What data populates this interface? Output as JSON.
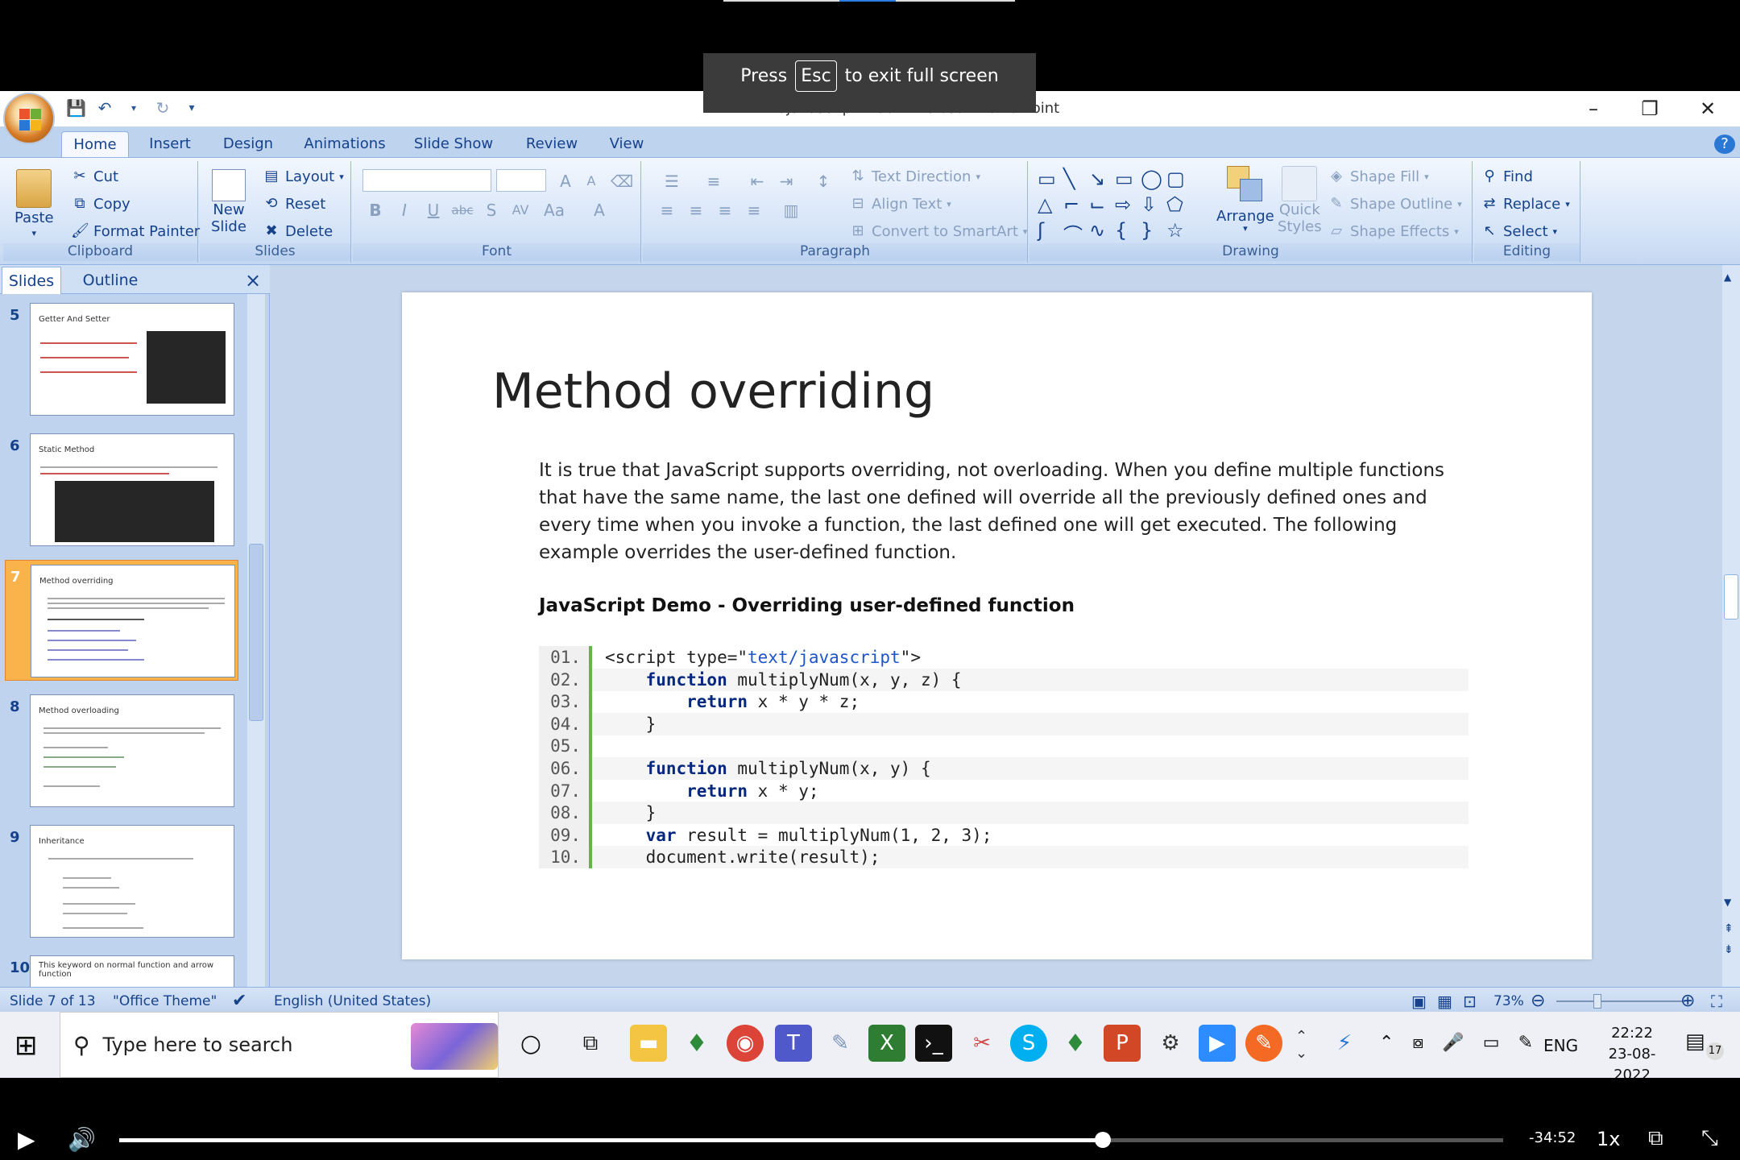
{
  "fullscreen_notice": {
    "press": "Press",
    "key": "Esc",
    "rest": "to exit full screen"
  },
  "window": {
    "title": "8javascript -ES6 - Microsoft PowerPoint",
    "minimize": "–",
    "restore": "❐",
    "close": "✕"
  },
  "ribbon_tabs": [
    "Home",
    "Insert",
    "Design",
    "Animations",
    "Slide Show",
    "Review",
    "View"
  ],
  "clipboard": {
    "paste": "Paste",
    "cut": "Cut",
    "copy": "Copy",
    "format_painter": "Format Painter",
    "label": "Clipboard"
  },
  "slides_group": {
    "new_slide": "New",
    "new_slide2": "Slide",
    "layout": "Layout",
    "reset": "Reset",
    "delete": "Delete",
    "label": "Slides"
  },
  "font_group": {
    "label": "Font",
    "bold": "B",
    "italic": "I",
    "underline": "U",
    "strike": "abc",
    "shadow": "S",
    "spacing": "AV",
    "case": "Aa",
    "color": "A"
  },
  "paragraph_group": {
    "label": "Paragraph",
    "text_direction": "Text Direction",
    "align_text": "Align Text",
    "smartart": "Convert to SmartArt"
  },
  "drawing_group": {
    "label": "Drawing",
    "arrange": "Arrange",
    "quick_styles": "Quick",
    "quick_styles2": "Styles",
    "shape_fill": "Shape Fill",
    "shape_outline": "Shape Outline",
    "shape_effects": "Shape Effects"
  },
  "editing_group": {
    "label": "Editing",
    "find": "Find",
    "replace": "Replace",
    "select": "Select"
  },
  "panel_tabs": {
    "slides": "Slides",
    "outline": "Outline",
    "close": "×"
  },
  "thumbnails": [
    {
      "num": "5",
      "title": "Getter And Setter"
    },
    {
      "num": "6",
      "title": "Static Method"
    },
    {
      "num": "7",
      "title": "Method overriding"
    },
    {
      "num": "8",
      "title": "Method overloading"
    },
    {
      "num": "9",
      "title": "Inheritance"
    },
    {
      "num": "10",
      "title": "This keyword on normal function and arrow function"
    }
  ],
  "slide": {
    "title": "Method overriding",
    "body": "It is true that JavaScript supports overriding, not overloading. When you define multiple functions that have the same name, the last one defined will override all the previously defined ones and every time when you invoke a function, the last defined one will get executed. The following example overrides the user-defined function.",
    "demo_title": "JavaScript Demo - Overriding user-defined function",
    "code": [
      {
        "n": "01.",
        "pre": "<script type=\"",
        "str": "text/javascript",
        "post": "\">"
      },
      {
        "n": "02.",
        "kw": "function",
        "rest": " multiplyNum(x, y, z) {",
        "indent": "    "
      },
      {
        "n": "03.",
        "kw": "return",
        "rest": " x * y * z;",
        "indent": "        "
      },
      {
        "n": "04.",
        "rest": "}",
        "indent": "    "
      },
      {
        "n": "05.",
        "rest": "",
        "indent": ""
      },
      {
        "n": "06.",
        "kw": "function",
        "rest": " multiplyNum(x, y) {",
        "indent": "    "
      },
      {
        "n": "07.",
        "kw": "return",
        "rest": " x * y;",
        "indent": "        "
      },
      {
        "n": "08.",
        "rest": "}",
        "indent": "    "
      },
      {
        "n": "09.",
        "kw": "var",
        "rest": " result = multiplyNum(1, 2, 3);",
        "indent": "    "
      },
      {
        "n": "10.",
        "rest": "document.write(result);",
        "indent": "    "
      }
    ]
  },
  "status": {
    "slide": "Slide 7 of 13",
    "theme": "\"Office Theme\"",
    "language": "English (United States)",
    "zoom": "73%"
  },
  "taskbar": {
    "search_placeholder": "Type here to search",
    "lang": "ENG",
    "time": "22:22",
    "date": "23-08-2022",
    "notifications": "17"
  },
  "video": {
    "time_remaining": "-34:52",
    "speed": "1x",
    "progress_fraction": 0.711
  }
}
